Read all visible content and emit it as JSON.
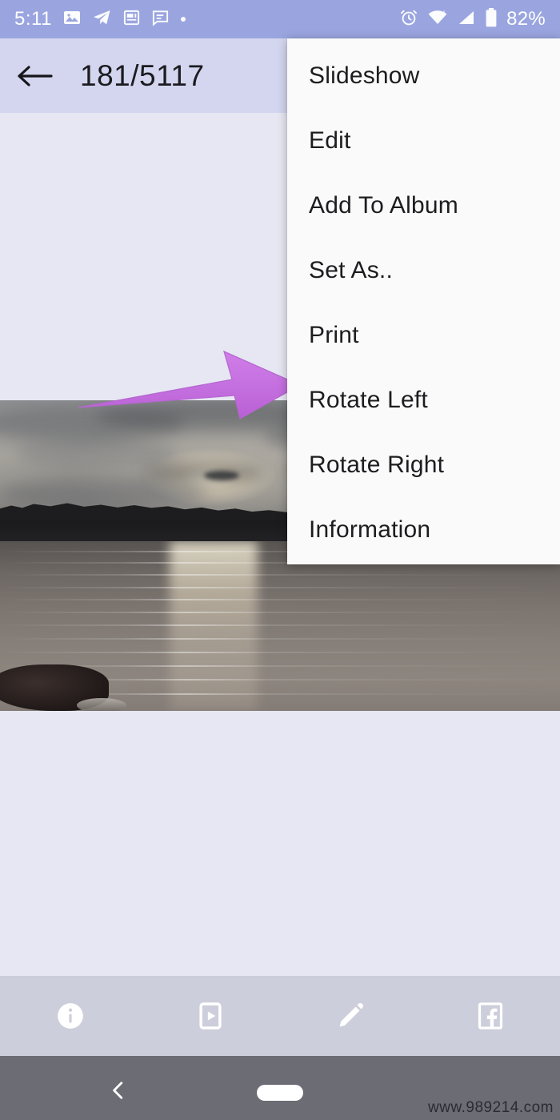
{
  "status_bar": {
    "time": "5:11",
    "battery_percent": "82%",
    "notification_icons": [
      "photo-icon",
      "telegram-icon",
      "news-icon",
      "message-icon",
      "dot-icon"
    ],
    "system_icons": [
      "alarm-icon",
      "wifi-icon",
      "signal-icon",
      "battery-icon"
    ],
    "background_color": "#9aa5e0"
  },
  "app_bar": {
    "back_label": "back-arrow",
    "title": "181/5117",
    "background_color": "#d3d6ee"
  },
  "popup_menu": {
    "items": [
      {
        "label": "Slideshow"
      },
      {
        "label": "Edit"
      },
      {
        "label": "Add To Album"
      },
      {
        "label": "Set As.."
      },
      {
        "label": "Print"
      },
      {
        "label": "Rotate Left"
      },
      {
        "label": "Rotate Right"
      },
      {
        "label": "Information"
      }
    ],
    "background_color": "#fafafa"
  },
  "annotation": {
    "type": "arrow",
    "color": "#c46fdf",
    "points_to": "Set As.."
  },
  "photo": {
    "description": "sunset over a lake with tree silhouettes",
    "alt": "sunset-photo"
  },
  "bottom_toolbar": {
    "buttons": [
      {
        "name": "info-icon",
        "label": "Information"
      },
      {
        "name": "slideshow-icon",
        "label": "Slideshow"
      },
      {
        "name": "edit-pencil-icon",
        "label": "Edit"
      },
      {
        "name": "facebook-icon",
        "label": "Facebook"
      }
    ],
    "background_color": "#cdcedb"
  },
  "nav_bar": {
    "back_label": "back-chevron",
    "home_label": "home-pill",
    "background_color": "#6b6c74"
  },
  "watermark": {
    "text": "www.989214.com"
  },
  "page_background": "#e6e7f2"
}
